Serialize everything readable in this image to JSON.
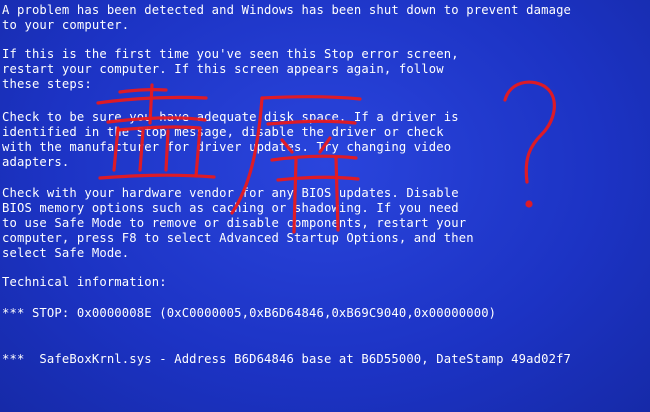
{
  "screen": {
    "background_color": "#1f35c9",
    "text_color": "#ffffff",
    "annotation_color": "#e8191d",
    "lines": [
      "A problem has been detected and Windows has been shut down to prevent damage",
      "to your computer.",
      "If this is the first time you've seen this Stop error screen,",
      "restart your computer. If this screen appears again, follow",
      "these steps:",
      "Check to be sure you have adequate disk space. If a driver is",
      "identified in the Stop message, disable the driver or check",
      "with the manufacturer for driver updates. Try changing video",
      "adapters.",
      "Check with your hardware vendor for any BIOS updates. Disable",
      "BIOS memory options such as caching or shadowing. If you need",
      "to use Safe Mode to remove or disable components, restart your",
      "computer, press F8 to select Advanced Startup Options, and then",
      "select Safe Mode.",
      "Technical information:",
      "*** STOP: 0x0000008E (0xC0000005,0xB6D64846,0xB69C9040,0x00000000)",
      "***  SafeBoxKrnl.sys - Address B6D64846 base at B6D55000, DateStamp 49ad02f7"
    ]
  },
  "annotation": {
    "handwriting_icon": "red-handwritten-bluescreen-chinese-characters-and-question-mark"
  }
}
